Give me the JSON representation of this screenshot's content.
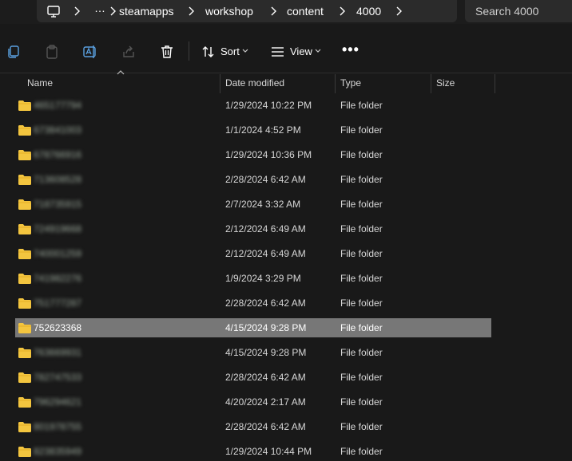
{
  "breadcrumb": {
    "overflow": "…",
    "items": [
      "steamapps",
      "workshop",
      "content",
      "4000"
    ]
  },
  "search": {
    "placeholder": "Search 4000"
  },
  "toolbar": {
    "sort_label": "Sort",
    "view_label": "View",
    "more_label": "•••"
  },
  "columns": {
    "name": "Name",
    "date": "Date modified",
    "type": "Type",
    "size": "Size"
  },
  "files": [
    {
      "name": "465177794",
      "date": "1/29/2024 10:22 PM",
      "type": "File folder",
      "redacted": true
    },
    {
      "name": "673841003",
      "date": "1/1/2024 4:52 PM",
      "type": "File folder",
      "redacted": true
    },
    {
      "name": "678766916",
      "date": "1/29/2024 10:36 PM",
      "type": "File folder",
      "redacted": true
    },
    {
      "name": "713608528",
      "date": "2/28/2024 6:42 AM",
      "type": "File folder",
      "redacted": true
    },
    {
      "name": "718735915",
      "date": "2/7/2024 3:32 AM",
      "type": "File folder",
      "redacted": true
    },
    {
      "name": "724919668",
      "date": "2/12/2024 6:49 AM",
      "type": "File folder",
      "redacted": true
    },
    {
      "name": "740001259",
      "date": "2/12/2024 6:49 AM",
      "type": "File folder",
      "redacted": true
    },
    {
      "name": "741982276",
      "date": "1/9/2024 3:29 PM",
      "type": "File folder",
      "redacted": true
    },
    {
      "name": "751777287",
      "date": "2/28/2024 6:42 AM",
      "type": "File folder",
      "redacted": true
    },
    {
      "name": "752623368",
      "date": "4/15/2024 9:28 PM",
      "type": "File folder",
      "redacted": false,
      "selected": true
    },
    {
      "name": "763669931",
      "date": "4/15/2024 9:28 PM",
      "type": "File folder",
      "redacted": true
    },
    {
      "name": "782747533",
      "date": "2/28/2024 6:42 AM",
      "type": "File folder",
      "redacted": true
    },
    {
      "name": "796294621",
      "date": "4/20/2024 2:17 AM",
      "type": "File folder",
      "redacted": true
    },
    {
      "name": "801978755",
      "date": "2/28/2024 6:42 AM",
      "type": "File folder",
      "redacted": true
    },
    {
      "name": "823835949",
      "date": "1/29/2024 10:44 PM",
      "type": "File folder",
      "redacted": true
    }
  ],
  "colors": {
    "background": "#191919",
    "selected_row": "#777777",
    "folder": "#f3c53f"
  }
}
